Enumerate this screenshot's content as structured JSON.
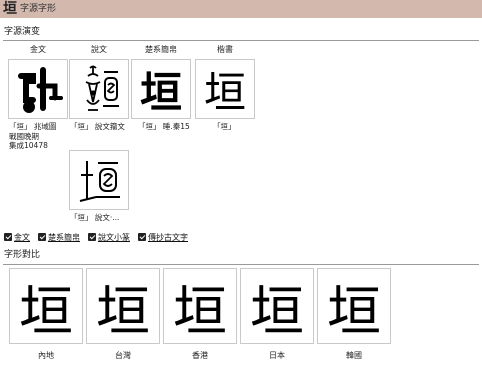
{
  "header": {
    "char": "垣",
    "title": "字源字形"
  },
  "evolution": {
    "title": "字源演变",
    "columns": [
      {
        "label": "金文",
        "glyph": "",
        "caption": "「垣」 兆域圖\n戰國晚期\n集成10478"
      },
      {
        "label": "說文",
        "glyph": "",
        "caption": "「垣」 說文籀文"
      },
      {
        "label": "楚系簡帛",
        "glyph": "垣",
        "caption": "「垣」 睡.秦15"
      },
      {
        "label": "楷書",
        "glyph": "垣",
        "caption": "「垣」"
      }
    ],
    "extra": {
      "glyph": "",
      "caption": "「垣」 說文‧..."
    }
  },
  "links": [
    {
      "label": "金文"
    },
    {
      "label": "楚系簡帛"
    },
    {
      "label": "說文小篆"
    },
    {
      "label": "傳抄古文字"
    }
  ],
  "comparison": {
    "title": "字形對比",
    "regions": [
      {
        "label": "內地",
        "glyph": "垣"
      },
      {
        "label": "台灣",
        "glyph": "垣"
      },
      {
        "label": "香港",
        "glyph": "垣"
      },
      {
        "label": "日本",
        "glyph": "垣"
      },
      {
        "label": "韓國",
        "glyph": "垣"
      }
    ]
  }
}
